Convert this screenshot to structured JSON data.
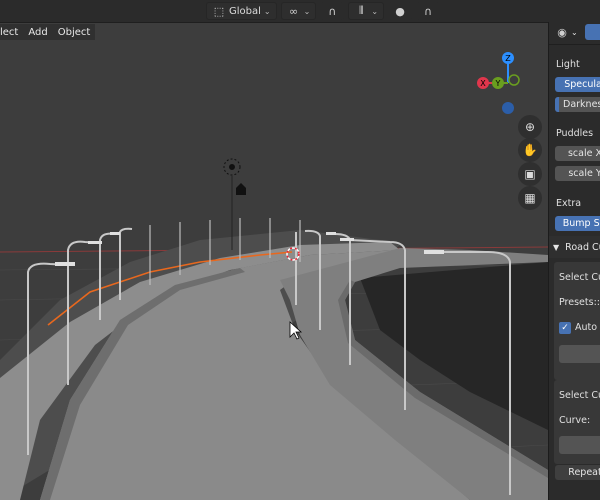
{
  "header": {
    "orientation": {
      "label": "Global",
      "icon": "transform-orientation-icon"
    },
    "pivot_icon": "pivot-point-icon",
    "snap_icon": "snap-magnet-icon",
    "snap_increment_icon": "snap-increment-icon",
    "proportional_icon": "proportional-editing-icon",
    "falloff_icon": "falloff-curve-icon"
  },
  "menubar": {
    "select": "lect",
    "add": "Add",
    "object": "Object"
  },
  "gizmo": {
    "x": "X",
    "y": "Y",
    "z": "Z",
    "colors": {
      "x": "#e0364c",
      "y": "#6a9e1f",
      "z": "#2c8fff"
    }
  },
  "nav": {
    "zoom": "zoom-icon",
    "pan": "pan-hand-icon",
    "camera": "camera-icon",
    "ortho": "grid-ortho-icon"
  },
  "sidepanel": {
    "light_title": "Light",
    "specular": "Specular",
    "darkness": "Darkness",
    "puddles_title": "Puddles",
    "scale_x": "scale X",
    "scale_y": "scale Y",
    "extra_title": "Extra",
    "bump": "Bump Str",
    "road_title": "Road Cu",
    "select_curve_1": "Select Cur",
    "presets": "Presets::",
    "auto": "Auto C",
    "select_curve_2": "Select Cus",
    "curve_label": "Curve:",
    "repeat": "Repeat"
  },
  "colors": {
    "accent": "#4772b3",
    "background": "#3d3d3d",
    "header": "#2b2b2b",
    "selection_orange": "#e8681e"
  }
}
